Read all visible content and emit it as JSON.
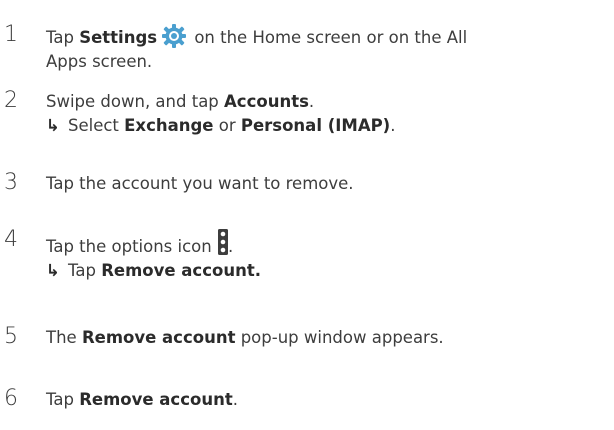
{
  "steps": [
    {
      "number": "1",
      "pre": "Tap ",
      "bold": "Settings",
      "icon": "settings-gear-icon",
      "post_line1": " on the Home screen or on the All",
      "post_line2": "Apps screen."
    },
    {
      "number": "2",
      "pre": "Swipe down, and tap ",
      "bold": "Accounts",
      "post": ".",
      "sub_arrow": "↳",
      "sub_pre": "Select ",
      "sub_bold1": "Exchange",
      "sub_mid": " or ",
      "sub_bold2": "Personal (IMAP)",
      "sub_post": "."
    },
    {
      "number": "3",
      "text": "Tap the account you want to remove."
    },
    {
      "number": "4",
      "pre": "Tap the options icon ",
      "icon": "options-kebab-icon",
      "post": ".",
      "sub_arrow": "↳",
      "sub_pre": "Tap ",
      "sub_bold": "Remove account."
    },
    {
      "number": "5",
      "pre": "The ",
      "bold": "Remove account",
      "post": " pop-up window appears."
    },
    {
      "number": "6",
      "pre": "Tap ",
      "bold": "Remove account",
      "post": "."
    }
  ],
  "colors": {
    "text": "#3d3d3d",
    "gear_icon": "#4a9fcf"
  }
}
